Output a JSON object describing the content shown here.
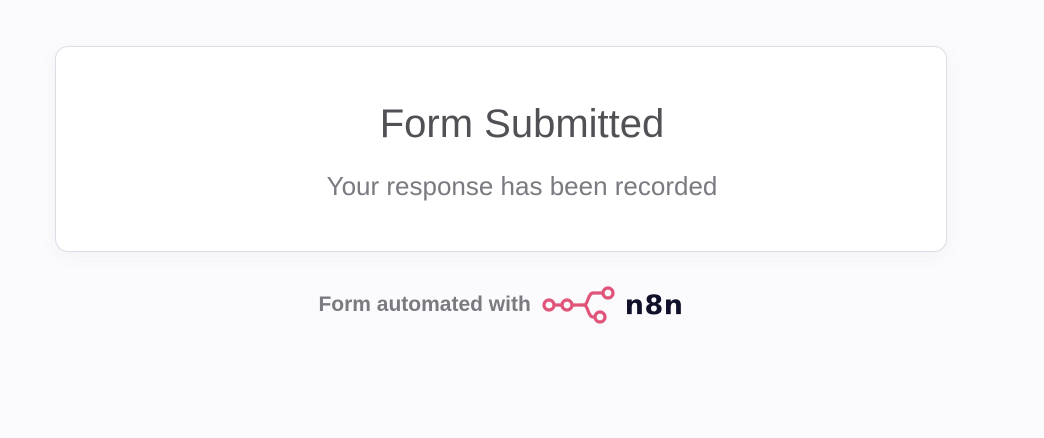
{
  "card": {
    "title": "Form Submitted",
    "message": "Your response has been recorded"
  },
  "footer": {
    "text": "Form automated with",
    "brand_name": "n8n",
    "brand_icon": "n8n-logo-icon",
    "brand_color": "#e0547a"
  },
  "colors": {
    "background": "#fbfbfd",
    "card": "#ffffff",
    "border": "#dcdde6",
    "title": "#505055",
    "subtitle": "#7a7a80"
  }
}
